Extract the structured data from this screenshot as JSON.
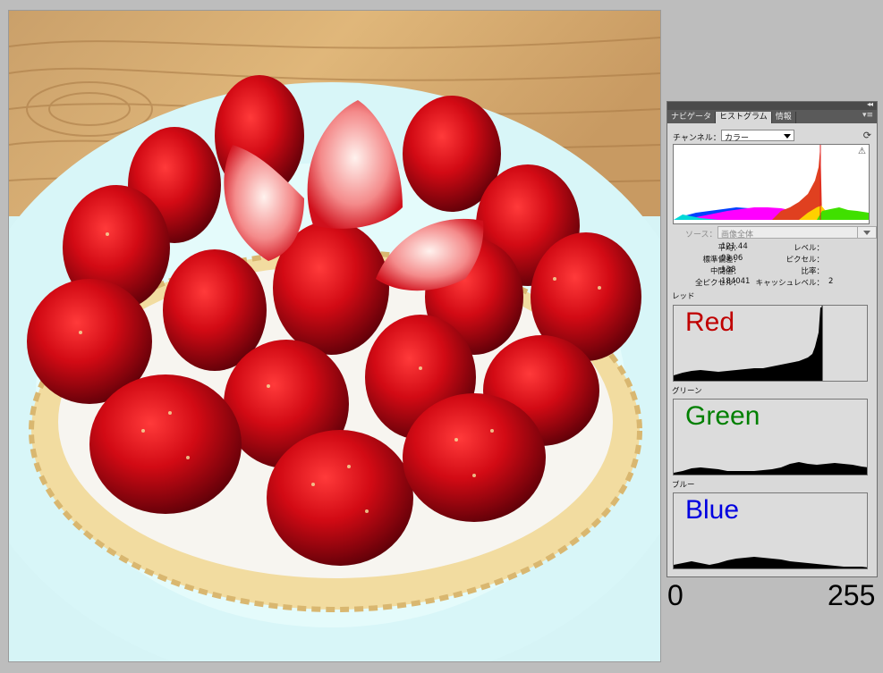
{
  "panel": {
    "tabs": [
      {
        "label": "ナビゲータ",
        "active": false
      },
      {
        "label": "ヒストグラム",
        "active": true
      },
      {
        "label": "情報",
        "active": false
      }
    ],
    "collapse_icon": "double-chevron-icon",
    "menu_icon": "panel-menu-icon",
    "channel_label": "チャンネル：",
    "channel_value": "カラー",
    "source_label": "ソース：",
    "source_value": "画像全体",
    "stats_left": [
      {
        "label": "平均：",
        "value": "121.44"
      },
      {
        "label": "標準偏差：",
        "value": "93.06"
      },
      {
        "label": "中間値：",
        "value": "138"
      },
      {
        "label": "全ピクセル：",
        "value": "184041"
      }
    ],
    "stats_right": [
      {
        "label": "レベル：",
        "value": ""
      },
      {
        "label": "ピクセル：",
        "value": ""
      },
      {
        "label": "比率：",
        "value": ""
      },
      {
        "label": "キャッシュレベル：",
        "value": "2"
      }
    ],
    "channels": [
      {
        "section_label": "レッド",
        "big_label": "Red",
        "color": "#c00000"
      },
      {
        "section_label": "グリーン",
        "big_label": "Green",
        "color": "#008000"
      },
      {
        "section_label": "ブルー",
        "big_label": "Blue",
        "color": "#0000e0"
      }
    ]
  },
  "axis": {
    "min_label": "0",
    "max_label": "255"
  }
}
